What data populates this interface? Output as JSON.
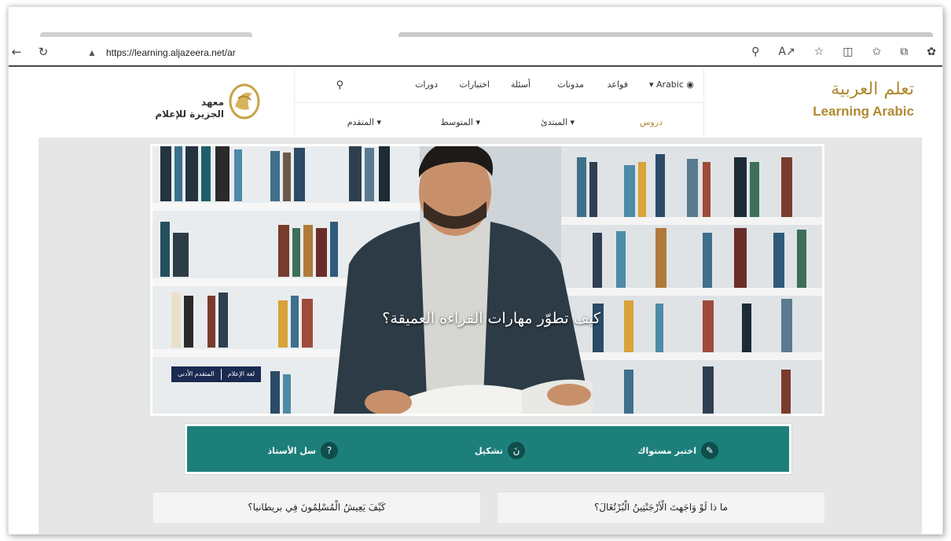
{
  "browser": {
    "back_icon": "back-arrow-icon",
    "reload_icon": "reload-icon",
    "url": "https://learning.aljazeera.net/ar",
    "toolbar_icons": [
      "zoom-icon",
      "read-aloud-icon",
      "favorite-star-icon",
      "split-screen-icon",
      "favorites-list-icon",
      "collections-icon",
      "extensions-icon"
    ]
  },
  "brand": {
    "arabic": "تعلم العربية",
    "english": "Learning Arabic",
    "color": "#b08a32"
  },
  "nav": {
    "language": "Arabic",
    "top_items": [
      "قواعد",
      "مدونات",
      "أسئلة",
      "اختبارات",
      "دورات"
    ],
    "lessons_label": "دروس",
    "bottom_items": [
      "المبتدئ",
      "المتوسط",
      "المتقدم"
    ]
  },
  "institute": {
    "line1": "معهد",
    "line2": "الجزيرة للإعلام"
  },
  "hero": {
    "title": "كيف تطوّر مهارات القراءة العميقة؟",
    "tag1": "لغة الإعلام",
    "tag2": "المتقدم الأدنى"
  },
  "actions": {
    "accent": "#1d7f7a",
    "level_test": "اختبر مستواك",
    "diacritics": "تشكيل",
    "diacritics_glyph": "نَ",
    "ask_teacher": "سل الأستاذ",
    "ask_glyph": "?"
  },
  "cards": {
    "right": "ما ذا لَوْ وَاجَهتَ الْأرْجَنْتِينُ الْبُرْتُغَالَ؟",
    "left": "كَيْفَ يَعِيشُ الْمُسْلِمُونَ فِي بريطانيا؟"
  }
}
